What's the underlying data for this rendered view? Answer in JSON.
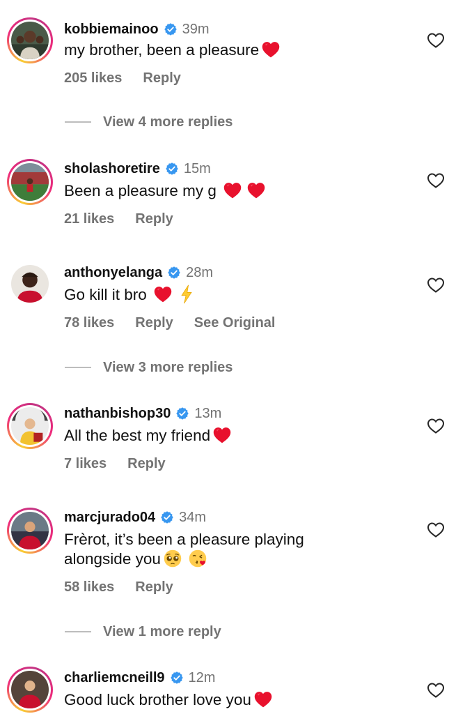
{
  "comments": [
    {
      "username": "kobbiemainoo",
      "time": "39m",
      "text": "my brother, been a pleasure",
      "likes": "205 likes",
      "reply": "Reply"
    },
    {
      "username": "sholashoretire",
      "time": "15m",
      "text": "Been a pleasure my g ",
      "likes": "21 likes",
      "reply": "Reply"
    },
    {
      "username": "anthonyelanga",
      "time": "28m",
      "text": "Go kill it bro ",
      "likes": "78 likes",
      "reply": "Reply",
      "see_original": "See Original"
    },
    {
      "username": "nathanbishop30",
      "time": "13m",
      "text": "All the best my friend",
      "likes": "7 likes",
      "reply": "Reply"
    },
    {
      "username": "marcjurado04",
      "time": "34m",
      "text_line1": "Frèrot, it’s been a pleasure playing",
      "text_line2": "alongside you",
      "likes": "58 likes",
      "reply": "Reply"
    },
    {
      "username": "charliemcneill9",
      "time": "12m",
      "text": "Good luck brother love you"
    }
  ],
  "more_replies": [
    "View 4 more replies",
    "View 3 more replies",
    "View 1 more reply"
  ],
  "icons": {
    "verified": "verified-badge-icon",
    "like": "heart-outline-icon",
    "red_heart": "red-heart-emoji",
    "lightning": "lightning-emoji",
    "pleading": "pleading-face-emoji",
    "kiss": "face-blowing-kiss-emoji"
  },
  "colors": {
    "verified_blue": "#3897f0",
    "secondary_text": "#737373",
    "heart_red": "#e0245e"
  }
}
